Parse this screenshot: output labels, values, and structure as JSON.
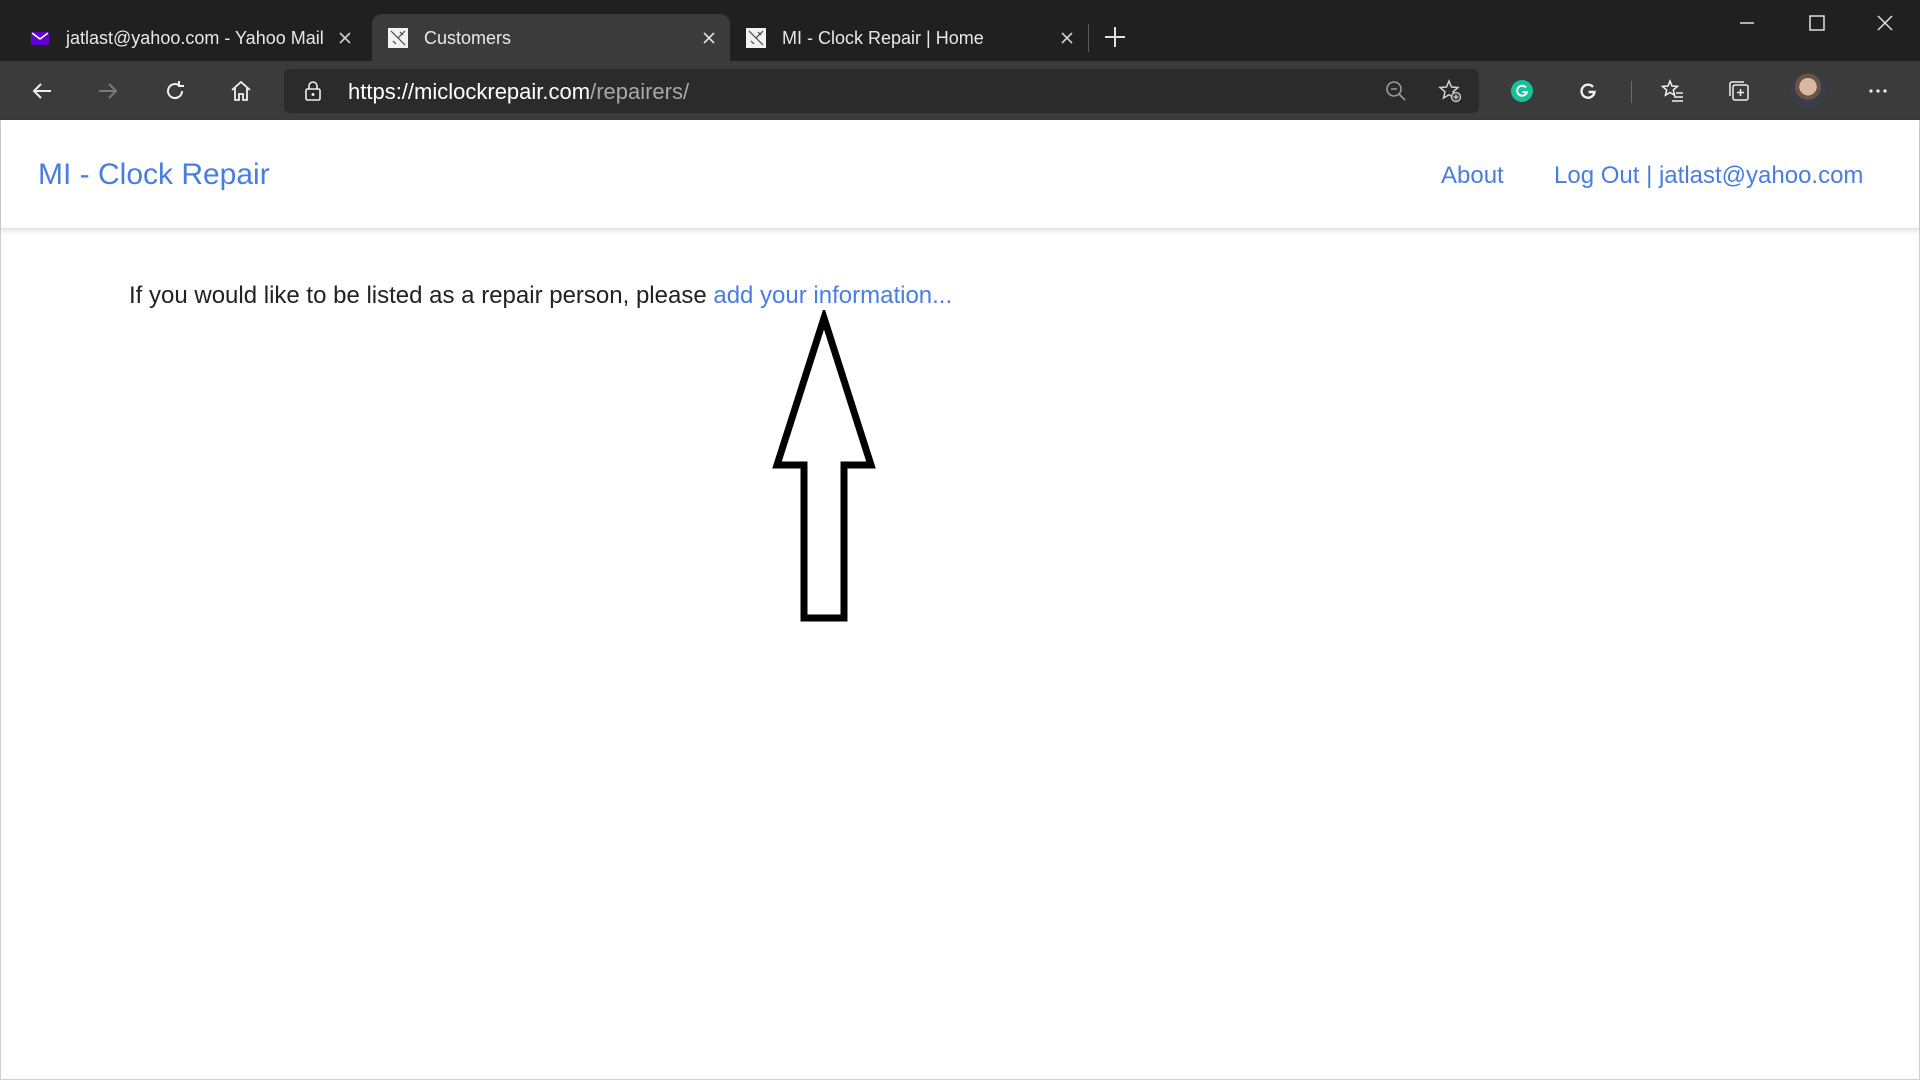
{
  "browser": {
    "tabs": [
      {
        "title": "jatlast@yahoo.com - Yahoo Mail",
        "icon": "mail-envelope-icon",
        "active": false
      },
      {
        "title": "Customers",
        "icon": "site-favicon-icon",
        "active": true
      },
      {
        "title": "MI - Clock Repair | Home",
        "icon": "site-favicon-icon",
        "active": false
      }
    ],
    "url": {
      "host": "https://miclockrepair.com",
      "path": "/repairers/"
    },
    "colors": {
      "tabstrip": "#202020",
      "toolbar": "#3b3b3b",
      "grammarly": "#15c39a",
      "yahoo_purple": "#6001d2"
    }
  },
  "site": {
    "brand": "MI - Clock Repair",
    "nav": {
      "about": "About",
      "logout": "Log Out | jatlast@yahoo.com"
    },
    "message": {
      "text": "If you would like to be listed as a repair person, please ",
      "link": "add your information..."
    },
    "colors": {
      "link": "#4a7de0",
      "text": "#222222"
    }
  },
  "annotation": {
    "icon": "up-arrow-icon"
  }
}
